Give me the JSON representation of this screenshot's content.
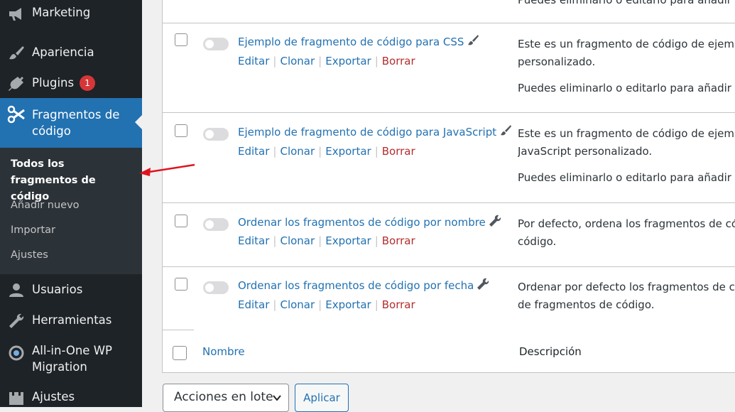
{
  "sidebar": {
    "items": [
      {
        "label": "Marketing",
        "icon": "megaphone-icon"
      },
      {
        "label": "Apariencia",
        "icon": "paintbrush-icon"
      },
      {
        "label": "Plugins",
        "icon": "plugin-icon",
        "badge": "1"
      },
      {
        "label": "Fragmentos de código",
        "icon": "scissors-icon",
        "active": true
      },
      {
        "label": "Usuarios",
        "icon": "user-icon"
      },
      {
        "label": "Herramientas",
        "icon": "wrench-icon"
      },
      {
        "label": "All-in-One WP Migration",
        "icon": "migration-icon"
      },
      {
        "label": "Ajustes",
        "icon": "settings-icon"
      }
    ],
    "submenu": [
      {
        "label": "Todos los fragmentos de código",
        "current": true
      },
      {
        "label": "Añadir nuevo"
      },
      {
        "label": "Importar"
      },
      {
        "label": "Ajustes"
      }
    ]
  },
  "table": {
    "top_fragment": "Puedes eliminarlo o editarlo para añadir tu",
    "rows": [
      {
        "title": "Ejemplo de fragmento de código para CSS",
        "type_icon": "paintbrush-icon",
        "desc": [
          "Este es un fragmento de código de ejemplo",
          "personalizado.",
          "Puedes eliminarlo o editarlo para añadir tu"
        ]
      },
      {
        "title": "Ejemplo de fragmento de código para JavaScript",
        "type_icon": "paintbrush-icon",
        "desc": [
          "Este es un fragmento de código de ejemplo",
          "JavaScript personalizado.",
          "Puedes eliminarlo o editarlo para añadir tu"
        ]
      },
      {
        "title": "Ordenar los fragmentos de código por nombre",
        "type_icon": "wrench-icon",
        "desc": [
          "Por defecto, ordena los fragmentos de códi",
          "código."
        ]
      },
      {
        "title": "Ordenar los fragmentos de código por fecha",
        "type_icon": "wrench-icon",
        "desc": [
          "Ordenar por defecto los fragmentos de códi",
          "de fragmentos de código."
        ]
      }
    ],
    "row_actions": {
      "edit": "Editar",
      "clone": "Clonar",
      "export": "Exportar",
      "delete": "Borrar",
      "sep": "|"
    },
    "footer": {
      "name_col": "Nombre",
      "desc_col": "Descripción"
    }
  },
  "bulk": {
    "selected": "Acciones en lote",
    "apply": "Aplicar"
  },
  "colors": {
    "sidebar_bg": "#1d2327",
    "accent": "#2271b1",
    "danger": "#b32d2e",
    "badge": "#d63638",
    "annotation_arrow": "#e0141e"
  }
}
